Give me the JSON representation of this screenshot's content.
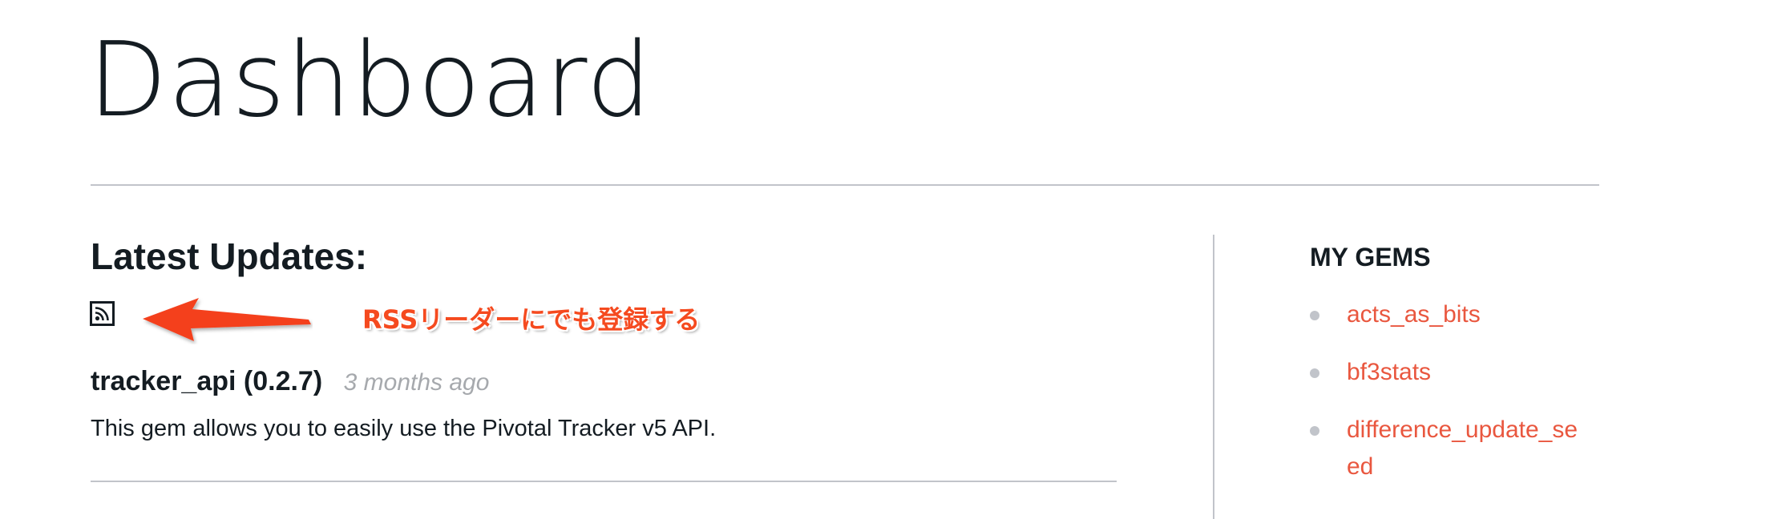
{
  "page": {
    "title": "Dashboard"
  },
  "updates": {
    "heading": "Latest Updates:",
    "rss_icon": "rss-feed-icon",
    "annotation_text": "RSSリーダーにでも登録する",
    "annotation_color": "#f54a1f",
    "entries": [
      {
        "name": "tracker_api (0.2.7)",
        "time_ago": "3 months ago",
        "description": "This gem allows you to easily use the Pivotal Tracker v5 API."
      }
    ]
  },
  "my_gems": {
    "heading": "MY GEMS",
    "items": [
      {
        "label": "acts_as_bits"
      },
      {
        "label": "bf3stats"
      },
      {
        "label": "difference_update_seed"
      }
    ]
  },
  "colors": {
    "text": "#141c22",
    "link": "#e9573f",
    "muted": "#a6a9ad",
    "rule": "#c1c4ca"
  }
}
